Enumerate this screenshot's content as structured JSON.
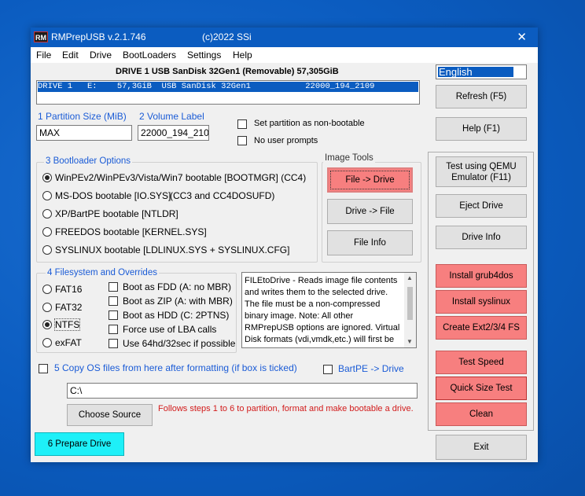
{
  "window": {
    "app_badge": "RM",
    "title": "RMPrepUSB v.2.1.746",
    "copyright": "(c)2022 SSi",
    "close_glyph": "✕"
  },
  "menu": [
    "File",
    "Edit",
    "Drive",
    "BootLoaders",
    "Settings",
    "Help"
  ],
  "drive_header": "DRIVE 1 USB SanDisk 32Gen1  (Removable) 57,305GiB",
  "language": "English",
  "drive_row": "DRIVE 1   E:    57,3GiB  USB SanDisk 32Gen1           22000_194_2109",
  "partition": {
    "size_label": "1 Partition Size (MiB)",
    "size_value": "MAX",
    "volume_label": "2 Volume Label",
    "volume_value": "22000_194_2109"
  },
  "options": {
    "non_bootable": "Set partition as non-bootable",
    "no_prompts": "No user prompts"
  },
  "bootloader": {
    "title": "3 Bootloader Options",
    "items": [
      "WinPEv2/WinPEv3/Vista/Win7 bootable [BOOTMGR] (CC4)",
      "MS-DOS bootable [IO.SYS]",
      "XP/BartPE bootable [NTLDR]",
      "FREEDOS bootable [KERNEL.SYS]",
      "SYSLINUX bootable [LDLINUX.SYS + SYSLINUX.CFG]"
    ],
    "msdos_extra": "(CC3 and CC4DOSUFD)",
    "selected_index": 0
  },
  "image_tools": {
    "title": "Image Tools",
    "file_to_drive": "File -> Drive",
    "drive_to_file": "Drive -> File",
    "file_info": "File Info"
  },
  "filesystem": {
    "title": "4 Filesystem and Overrides",
    "types": [
      "FAT16",
      "FAT32",
      "NTFS",
      "exFAT"
    ],
    "selected": "NTFS",
    "overrides": [
      "Boot as FDD (A: no MBR)",
      "Boot as ZIP (A: with MBR)",
      "Boot as HDD (C: 2PTNS)",
      "Force use of LBA calls",
      "Use 64hd/32sec if possible"
    ]
  },
  "info_text": "FILEtoDrive - Reads image file contents and writes them to the selected drive. The file must be a non-compressed binary image. Note: All other RMPrepUSB options are ignored. Virtual Disk formats (vdi,vmdk,etc.) will first be",
  "copy_os": {
    "label": "5 Copy OS files from here after formatting (if box is ticked)",
    "bartpe": "BartPE -> Drive",
    "path": "C:\\",
    "choose_source": "Choose Source",
    "follows": "Follows steps 1 to 6 to partition, format and make bootable a drive."
  },
  "prepare_drive": "6 Prepare Drive",
  "right": {
    "refresh": "Refresh (F5)",
    "help": "Help (F1)",
    "qemu": "Test using QEMU Emulator (F11)",
    "eject": "Eject Drive",
    "drive_info": "Drive Info",
    "grub4dos": "Install grub4dos",
    "syslinux": "Install syslinux",
    "ext": "Create Ext2/3/4 FS",
    "test_speed": "Test Speed",
    "quick_size": "Quick Size Test",
    "clean": "Clean",
    "exit": "Exit"
  },
  "colors": {
    "accent": "#0b5cc0",
    "danger_button": "#f77f7f",
    "prepare_button": "#1ef0f8",
    "section_label": "#1a5bd6"
  }
}
